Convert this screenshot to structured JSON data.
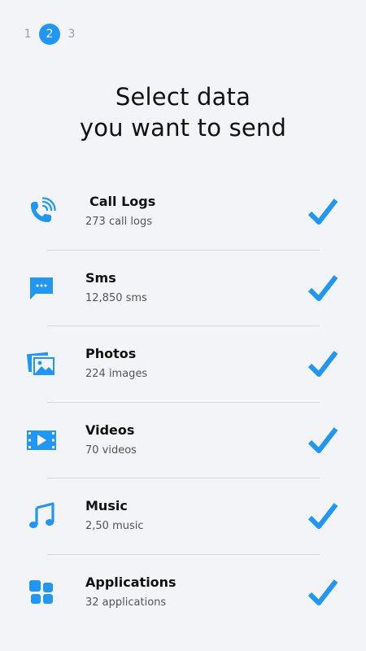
{
  "stepper": {
    "steps": [
      "1",
      "2",
      "3"
    ],
    "active": "2"
  },
  "title": {
    "line1": "Select data",
    "line2": "you want to send"
  },
  "items": [
    {
      "label": "Call Logs",
      "sub": "273  call logs",
      "icon": "phone-call-icon",
      "checked": true
    },
    {
      "label": "Sms",
      "sub": "12,850  sms",
      "icon": "chat-bubble-icon",
      "checked": true
    },
    {
      "label": "Photos",
      "sub": "224 images",
      "icon": "photos-icon",
      "checked": true
    },
    {
      "label": "Videos",
      "sub": "70 videos",
      "icon": "film-icon",
      "checked": true
    },
    {
      "label": "Music",
      "sub": "2,50 music",
      "icon": "music-note-icon",
      "checked": true
    },
    {
      "label": "Applications",
      "sub": "32 applications",
      "icon": "apps-grid-icon",
      "checked": true
    }
  ],
  "colors": {
    "accent": "#2196f3",
    "background": "#f3f4f8"
  }
}
